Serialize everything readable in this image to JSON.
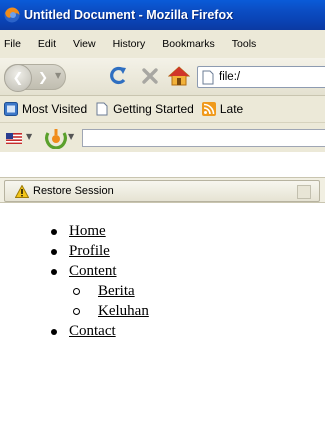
{
  "window": {
    "title": "Untitled Document - Mozilla Firefox"
  },
  "menu": [
    "File",
    "Edit",
    "View",
    "History",
    "Bookmarks",
    "Tools"
  ],
  "address": {
    "url": "file:/"
  },
  "bookmarks": [
    "Most Visited",
    "Getting Started",
    "Late"
  ],
  "notification": {
    "label": "Restore Session"
  },
  "page": {
    "nav": [
      {
        "label": "Home"
      },
      {
        "label": "Profile"
      },
      {
        "label": "Content",
        "children": [
          {
            "label": "Berita"
          },
          {
            "label": "Keluhan"
          }
        ]
      },
      {
        "label": "Contact"
      }
    ]
  }
}
